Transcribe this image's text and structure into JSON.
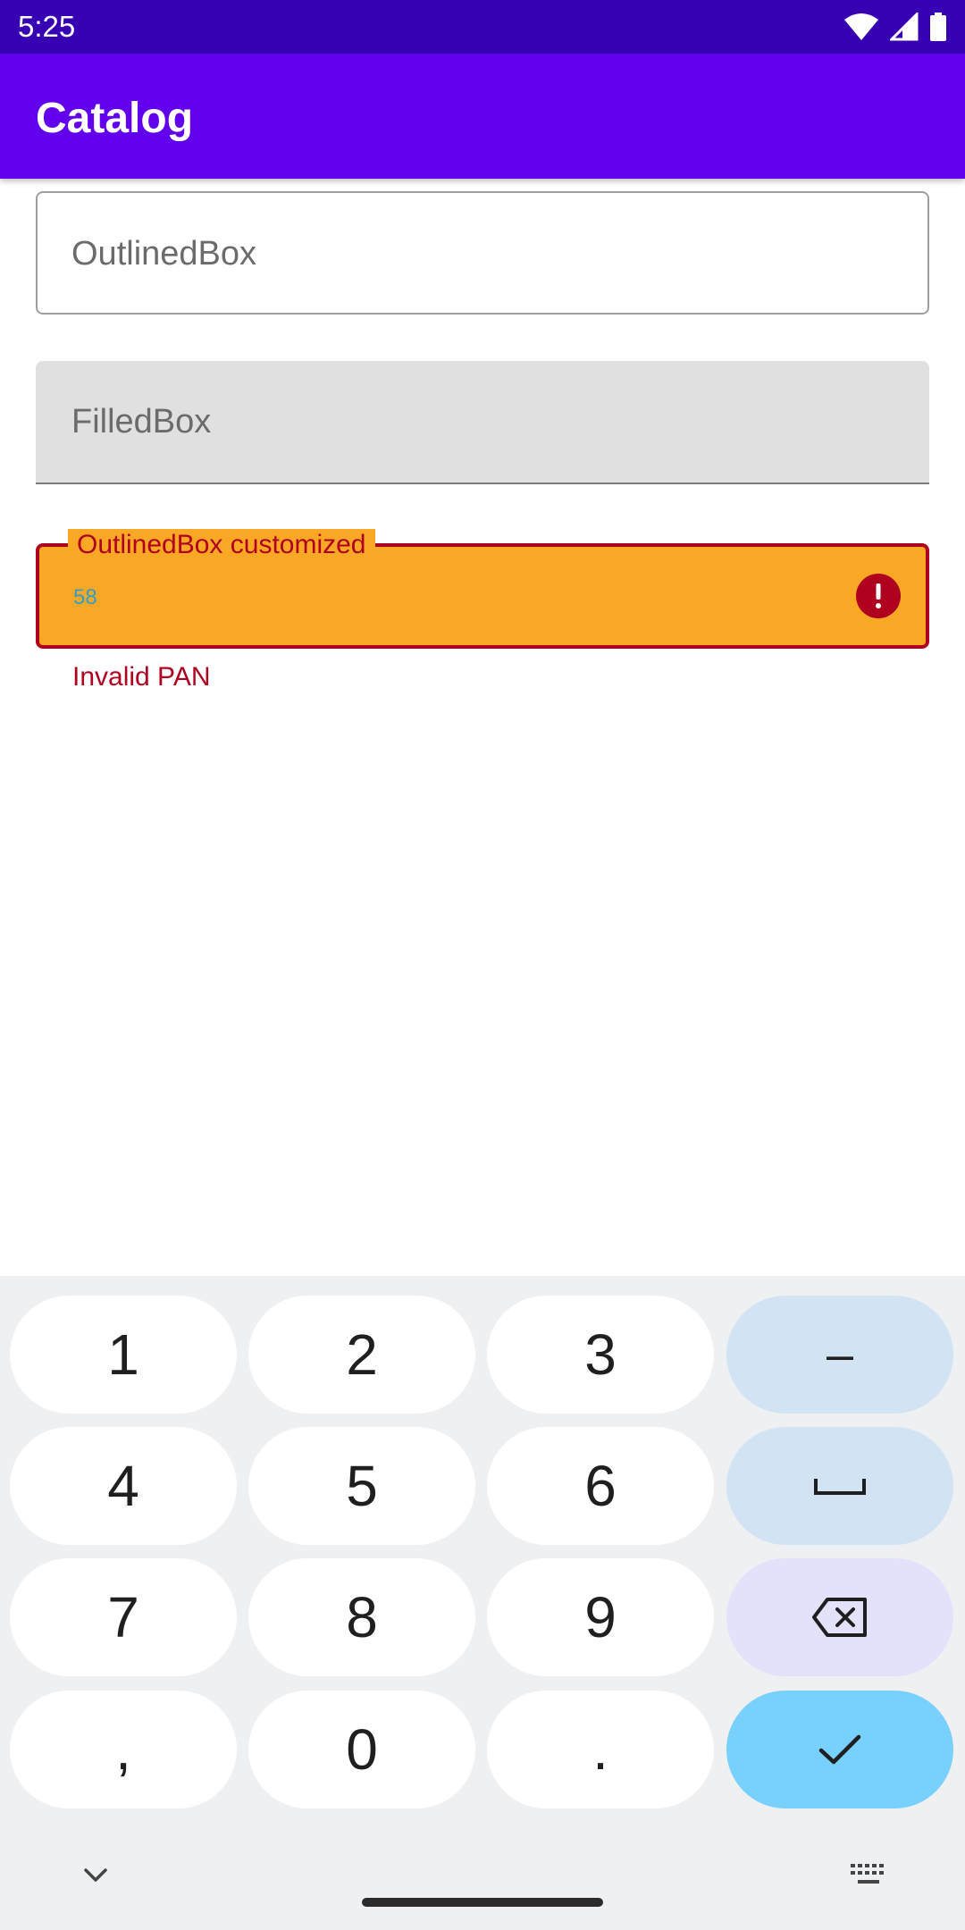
{
  "status_bar": {
    "time": "5:25",
    "icons": [
      "wifi-icon",
      "signal-icon",
      "battery-icon"
    ]
  },
  "app_bar": {
    "title": "Catalog"
  },
  "fields": {
    "outlined": {
      "label": "OutlinedBox"
    },
    "filled": {
      "label": "FilledBox"
    },
    "customized": {
      "label": "OutlinedBox customized",
      "value": "58",
      "helper_text": "Invalid PAN",
      "icon": "error-icon"
    }
  },
  "keyboard": {
    "keys": [
      "1",
      "2",
      "3",
      "–",
      "4",
      "5",
      "6",
      "␣",
      "7",
      "8",
      "9",
      "⌫",
      ",",
      "0",
      ".",
      "✓"
    ],
    "row1": {
      "k1": "1",
      "k2": "2",
      "k3": "3",
      "k4": "–"
    },
    "row2": {
      "k1": "4",
      "k2": "5",
      "k3": "6"
    },
    "row3": {
      "k1": "7",
      "k2": "8",
      "k3": "9"
    },
    "row4": {
      "k1": ",",
      "k2": "0",
      "k3": "."
    },
    "special_icons": [
      "space-icon",
      "backspace-icon",
      "check-icon",
      "chevron-down-icon",
      "keyboard-icon"
    ]
  },
  "colors": {
    "status_bar": "#3700b3",
    "app_bar": "#6200ee",
    "error": "#b00020",
    "custom_field_bg": "#f9a825",
    "value_text": "#2e9fc9",
    "confirm_key": "#78d0fc"
  }
}
